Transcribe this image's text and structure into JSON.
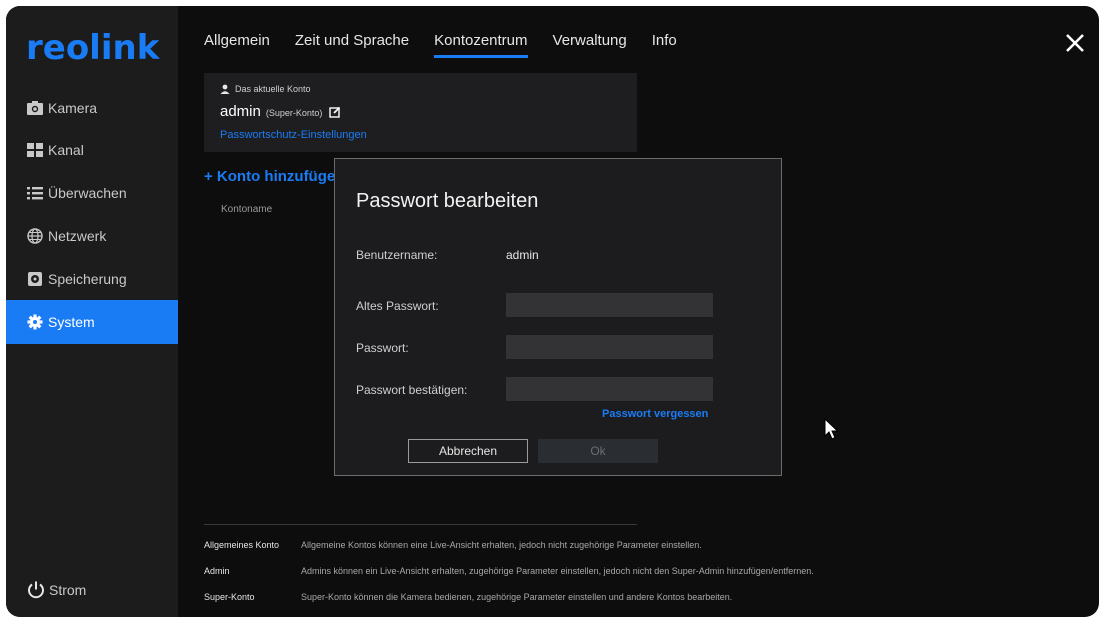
{
  "sidebar": {
    "logo": "reolink",
    "items": [
      {
        "label": "Kamera",
        "icon": "camera-icon"
      },
      {
        "label": "Kanal",
        "icon": "channel-grid-icon"
      },
      {
        "label": "Überwachen",
        "icon": "list-icon"
      },
      {
        "label": "Netzwerk",
        "icon": "globe-icon"
      },
      {
        "label": "Speicherung",
        "icon": "storage-icon"
      },
      {
        "label": "System",
        "icon": "gear-icon",
        "active": true
      }
    ],
    "power_label": "Strom"
  },
  "tabs": [
    {
      "label": "Allgemein"
    },
    {
      "label": "Zeit und Sprache"
    },
    {
      "label": "Kontozentrum",
      "active": true
    },
    {
      "label": "Verwaltung"
    },
    {
      "label": "Info"
    }
  ],
  "account": {
    "current_label": "Das aktuelle Konto",
    "name": "admin",
    "role": "(Super-Konto)",
    "pw_settings_link": "Passwortschutz-Einstellungen"
  },
  "add_account": "+ Konto hinzufügen",
  "table": {
    "col_name": "Kontoname"
  },
  "modal": {
    "title": "Passwort bearbeiten",
    "username_label": "Benutzername:",
    "username_value": "admin",
    "old_pw_label": "Altes Passwort:",
    "old_pw_value": "",
    "pw_label": "Passwort:",
    "pw_value": "",
    "confirm_label": "Passwort bestätigen:",
    "confirm_value": "",
    "forgot": "Passwort vergessen",
    "cancel": "Abbrechen",
    "ok": "Ok"
  },
  "roles": [
    {
      "name": "Allgemeines Konto",
      "desc": "Allgemeine Kontos können eine Live-Ansicht erhalten, jedoch nicht zugehörige Parameter einstellen."
    },
    {
      "name": "Admin",
      "desc": "Admins können ein Live-Ansicht erhalten, zugehörige Parameter einstellen, jedoch nicht den Super-Admin hinzufügen/entfernen."
    },
    {
      "name": "Super-Konto",
      "desc": "Super-Konto können die Kamera bedienen, zugehörige Parameter einstellen und andere Kontos bearbeiten."
    }
  ],
  "colors": {
    "accent": "#1a7cf5",
    "background": "#0d0d0d",
    "sidebar": "#1c1c1d"
  }
}
